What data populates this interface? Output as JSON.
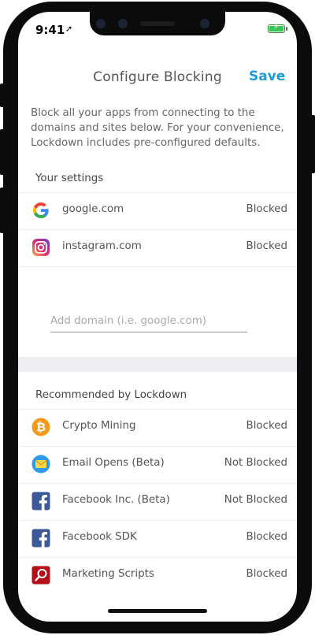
{
  "status_bar": {
    "time": "9:41",
    "location_arrow": "➚"
  },
  "header": {
    "title": "Configure Blocking",
    "save_label": "Save"
  },
  "description": "Block all your apps from connecting to the domains and sites below. For your convenience, Lockdown includes pre-configured defaults.",
  "your_settings": {
    "title": "Your settings",
    "items": [
      {
        "icon": "google-icon",
        "label": "google.com",
        "status": "Blocked"
      },
      {
        "icon": "instagram-icon",
        "label": "instagram.com",
        "status": "Blocked"
      }
    ],
    "add_domain_placeholder": "Add domain (i.e. google.com)"
  },
  "recommended": {
    "title": "Recommended by Lockdown",
    "items": [
      {
        "icon": "bitcoin-icon",
        "label": "Crypto Mining",
        "status": "Blocked"
      },
      {
        "icon": "email-icon",
        "label": "Email Opens (Beta)",
        "status": "Not Blocked"
      },
      {
        "icon": "facebook-icon",
        "label": "Facebook Inc. (Beta)",
        "status": "Not Blocked"
      },
      {
        "icon": "facebook-icon",
        "label": "Facebook SDK",
        "status": "Blocked"
      },
      {
        "icon": "magnifier-icon",
        "label": "Marketing Scripts",
        "status": "Blocked"
      }
    ]
  },
  "colors": {
    "accent": "#1b9bd7",
    "battery": "#35c759",
    "bitcoin": "#f39a1d",
    "facebook": "#3b5998",
    "marketing": "#b3101a"
  }
}
